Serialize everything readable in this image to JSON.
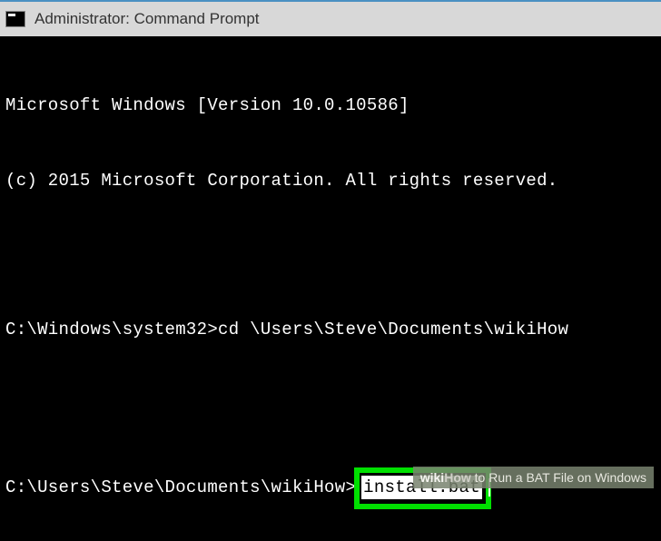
{
  "titlebar": {
    "text": "Administrator: Command Prompt"
  },
  "terminal": {
    "line1": "Microsoft Windows [Version 10.0.10586]",
    "line2": "(c) 2015 Microsoft Corporation. All rights reserved.",
    "prompt1": "C:\\Windows\\system32>",
    "cmd1": "cd \\Users\\Steve\\Documents\\wikiHow",
    "prompt2": "C:\\Users\\Steve\\Documents\\wikiHow>",
    "cmd2": "install.bat"
  },
  "watermark": {
    "brand_wiki": "wiki",
    "brand_how": "How",
    "suffix": " to Run a BAT File on Windows"
  }
}
